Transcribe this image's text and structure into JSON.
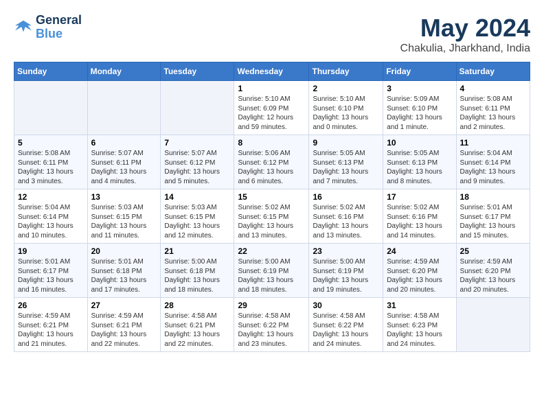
{
  "header": {
    "logo": {
      "line1": "General",
      "line2": "Blue"
    },
    "title": "May 2024",
    "subtitle": "Chakulia, Jharkhand, India"
  },
  "calendar": {
    "weekdays": [
      "Sunday",
      "Monday",
      "Tuesday",
      "Wednesday",
      "Thursday",
      "Friday",
      "Saturday"
    ],
    "weeks": [
      [
        {
          "day": null
        },
        {
          "day": null
        },
        {
          "day": null
        },
        {
          "day": 1,
          "sunrise": "5:10 AM",
          "sunset": "6:09 PM",
          "daylight": "12 hours and 59 minutes."
        },
        {
          "day": 2,
          "sunrise": "5:10 AM",
          "sunset": "6:10 PM",
          "daylight": "13 hours and 0 minutes."
        },
        {
          "day": 3,
          "sunrise": "5:09 AM",
          "sunset": "6:10 PM",
          "daylight": "13 hours and 1 minute."
        },
        {
          "day": 4,
          "sunrise": "5:08 AM",
          "sunset": "6:11 PM",
          "daylight": "13 hours and 2 minutes."
        }
      ],
      [
        {
          "day": 5,
          "sunrise": "5:08 AM",
          "sunset": "6:11 PM",
          "daylight": "13 hours and 3 minutes."
        },
        {
          "day": 6,
          "sunrise": "5:07 AM",
          "sunset": "6:11 PM",
          "daylight": "13 hours and 4 minutes."
        },
        {
          "day": 7,
          "sunrise": "5:07 AM",
          "sunset": "6:12 PM",
          "daylight": "13 hours and 5 minutes."
        },
        {
          "day": 8,
          "sunrise": "5:06 AM",
          "sunset": "6:12 PM",
          "daylight": "13 hours and 6 minutes."
        },
        {
          "day": 9,
          "sunrise": "5:05 AM",
          "sunset": "6:13 PM",
          "daylight": "13 hours and 7 minutes."
        },
        {
          "day": 10,
          "sunrise": "5:05 AM",
          "sunset": "6:13 PM",
          "daylight": "13 hours and 8 minutes."
        },
        {
          "day": 11,
          "sunrise": "5:04 AM",
          "sunset": "6:14 PM",
          "daylight": "13 hours and 9 minutes."
        }
      ],
      [
        {
          "day": 12,
          "sunrise": "5:04 AM",
          "sunset": "6:14 PM",
          "daylight": "13 hours and 10 minutes."
        },
        {
          "day": 13,
          "sunrise": "5:03 AM",
          "sunset": "6:15 PM",
          "daylight": "13 hours and 11 minutes."
        },
        {
          "day": 14,
          "sunrise": "5:03 AM",
          "sunset": "6:15 PM",
          "daylight": "13 hours and 12 minutes."
        },
        {
          "day": 15,
          "sunrise": "5:02 AM",
          "sunset": "6:15 PM",
          "daylight": "13 hours and 13 minutes."
        },
        {
          "day": 16,
          "sunrise": "5:02 AM",
          "sunset": "6:16 PM",
          "daylight": "13 hours and 13 minutes."
        },
        {
          "day": 17,
          "sunrise": "5:02 AM",
          "sunset": "6:16 PM",
          "daylight": "13 hours and 14 minutes."
        },
        {
          "day": 18,
          "sunrise": "5:01 AM",
          "sunset": "6:17 PM",
          "daylight": "13 hours and 15 minutes."
        }
      ],
      [
        {
          "day": 19,
          "sunrise": "5:01 AM",
          "sunset": "6:17 PM",
          "daylight": "13 hours and 16 minutes."
        },
        {
          "day": 20,
          "sunrise": "5:01 AM",
          "sunset": "6:18 PM",
          "daylight": "13 hours and 17 minutes."
        },
        {
          "day": 21,
          "sunrise": "5:00 AM",
          "sunset": "6:18 PM",
          "daylight": "13 hours and 18 minutes."
        },
        {
          "day": 22,
          "sunrise": "5:00 AM",
          "sunset": "6:19 PM",
          "daylight": "13 hours and 18 minutes."
        },
        {
          "day": 23,
          "sunrise": "5:00 AM",
          "sunset": "6:19 PM",
          "daylight": "13 hours and 19 minutes."
        },
        {
          "day": 24,
          "sunrise": "4:59 AM",
          "sunset": "6:20 PM",
          "daylight": "13 hours and 20 minutes."
        },
        {
          "day": 25,
          "sunrise": "4:59 AM",
          "sunset": "6:20 PM",
          "daylight": "13 hours and 20 minutes."
        }
      ],
      [
        {
          "day": 26,
          "sunrise": "4:59 AM",
          "sunset": "6:21 PM",
          "daylight": "13 hours and 21 minutes."
        },
        {
          "day": 27,
          "sunrise": "4:59 AM",
          "sunset": "6:21 PM",
          "daylight": "13 hours and 22 minutes."
        },
        {
          "day": 28,
          "sunrise": "4:58 AM",
          "sunset": "6:21 PM",
          "daylight": "13 hours and 22 minutes."
        },
        {
          "day": 29,
          "sunrise": "4:58 AM",
          "sunset": "6:22 PM",
          "daylight": "13 hours and 23 minutes."
        },
        {
          "day": 30,
          "sunrise": "4:58 AM",
          "sunset": "6:22 PM",
          "daylight": "13 hours and 24 minutes."
        },
        {
          "day": 31,
          "sunrise": "4:58 AM",
          "sunset": "6:23 PM",
          "daylight": "13 hours and 24 minutes."
        },
        {
          "day": null
        }
      ]
    ]
  }
}
